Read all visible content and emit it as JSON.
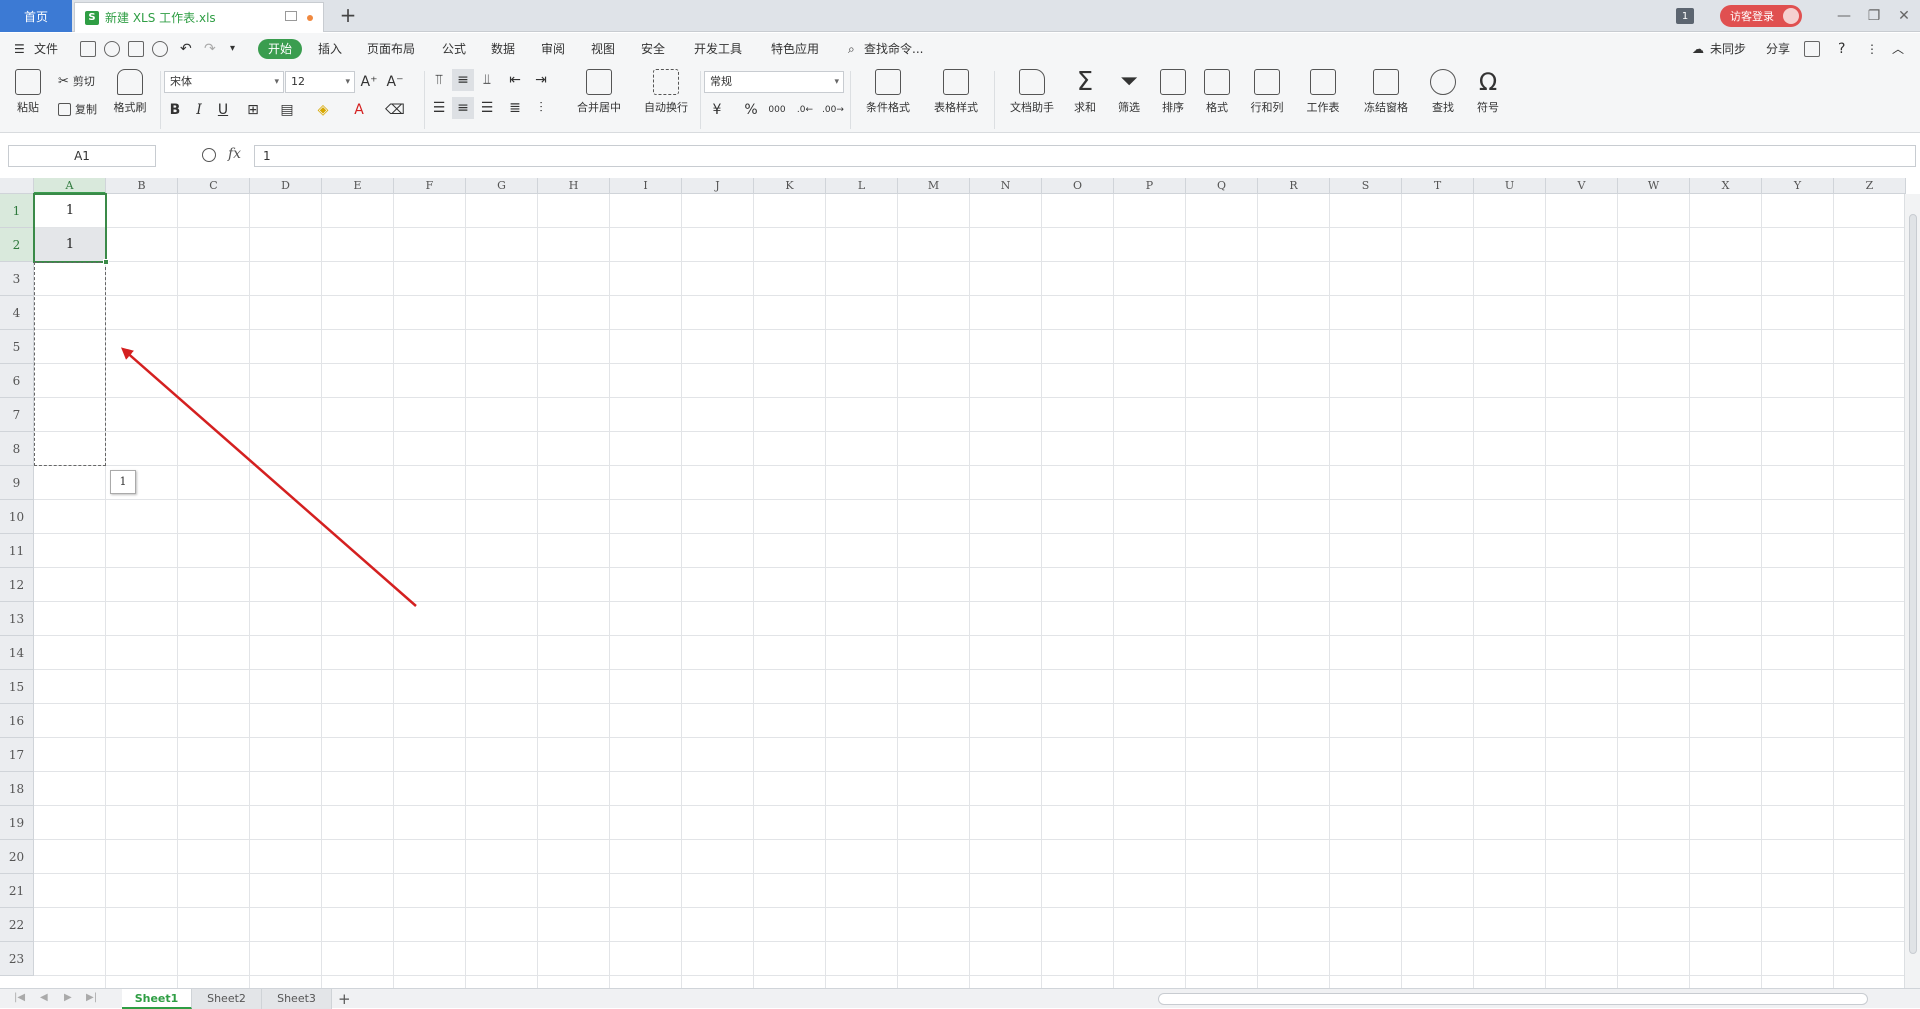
{
  "titlebar": {
    "home_tab": "首页",
    "file_tab": "新建 XLS 工作表.xls",
    "xls_icon_letter": "S",
    "badge": "1",
    "login": "访客登录",
    "new_tab": "+"
  },
  "menu": {
    "file": "文件",
    "items": [
      "开始",
      "插入",
      "页面布局",
      "公式",
      "数据",
      "审阅",
      "视图",
      "安全",
      "开发工具",
      "特色应用"
    ],
    "search": "查找命令...",
    "sync": "未同步",
    "share": "分享",
    "help": "?"
  },
  "ribbon": {
    "paste": "粘贴",
    "cut": "剪切",
    "copy": "复制",
    "format_painter": "格式刷",
    "font_name": "宋体",
    "font_size": "12",
    "bold": "B",
    "italic": "I",
    "underline": "U",
    "merge_center": "合并居中",
    "wrap_text": "自动换行",
    "number_format": "常规",
    "percent": "%",
    "thousands": "000",
    "conditional_format": "条件格式",
    "table_style": "表格样式",
    "doc_assistant": "文档助手",
    "sum": "求和",
    "filter": "筛选",
    "sort": "排序",
    "format": "格式",
    "rows_cols": "行和列",
    "worksheet": "工作表",
    "freeze": "冻结窗格",
    "find": "查找",
    "symbol": "符号"
  },
  "formula_bar": {
    "name_box": "A1",
    "fx": "fx",
    "value": "1"
  },
  "grid": {
    "columns": [
      "A",
      "B",
      "C",
      "D",
      "E",
      "F",
      "G",
      "H",
      "I",
      "J",
      "K",
      "L",
      "M",
      "N",
      "O",
      "P",
      "Q",
      "R",
      "S",
      "T",
      "U",
      "V",
      "W",
      "X",
      "Y",
      "Z"
    ],
    "rows": [
      "1",
      "2",
      "3",
      "4",
      "5",
      "6",
      "7",
      "8",
      "9",
      "10",
      "11",
      "12",
      "13",
      "14",
      "15",
      "16",
      "17",
      "18",
      "19",
      "20",
      "21",
      "22",
      "23"
    ],
    "cell_a1": "1",
    "cell_a2": "1",
    "autofill_tip": "1"
  },
  "sheets": [
    "Sheet1",
    "Sheet2",
    "Sheet3"
  ],
  "add_sheet": "+",
  "colors": {
    "accent_green": "#3a9d4f",
    "home_blue": "#3c7ad4",
    "login_red": "#e05050",
    "arrow_red": "#d42020"
  }
}
